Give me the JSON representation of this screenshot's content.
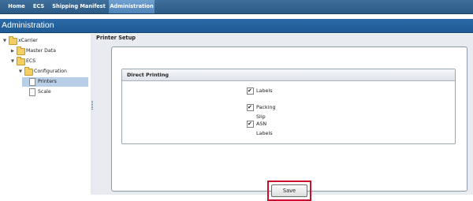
{
  "topnav": {
    "items": [
      "Home",
      "ECS",
      "Shipping Manifest",
      "Administration"
    ],
    "active": "Administration"
  },
  "page": {
    "title": "Administration"
  },
  "sidebar": {
    "tree": [
      {
        "label": "xCarrier",
        "type": "folder",
        "state": "expanded"
      },
      {
        "label": "Master Data",
        "type": "folder",
        "state": "collapsed"
      },
      {
        "label": "ECS",
        "type": "folder",
        "state": "expanded"
      },
      {
        "label": "Configuration",
        "type": "folder",
        "state": "expanded"
      },
      {
        "label": "Printers",
        "type": "doc",
        "selected": true
      },
      {
        "label": "Scale",
        "type": "doc",
        "selected": false
      }
    ]
  },
  "main": {
    "panel_title": "Printer Setup",
    "section_title": "Direct Printing",
    "checkboxes": [
      {
        "label": "Labels",
        "checked": true
      },
      {
        "label": "Packing Slip",
        "checked": true
      },
      {
        "label": "ASN Labels",
        "checked": true
      }
    ],
    "save_label": "Save"
  },
  "colors": {
    "nav": "#2c5a86",
    "titlebar": "#1f5a93",
    "selected": "#b9cfe8",
    "highlight": "#c8102e"
  }
}
